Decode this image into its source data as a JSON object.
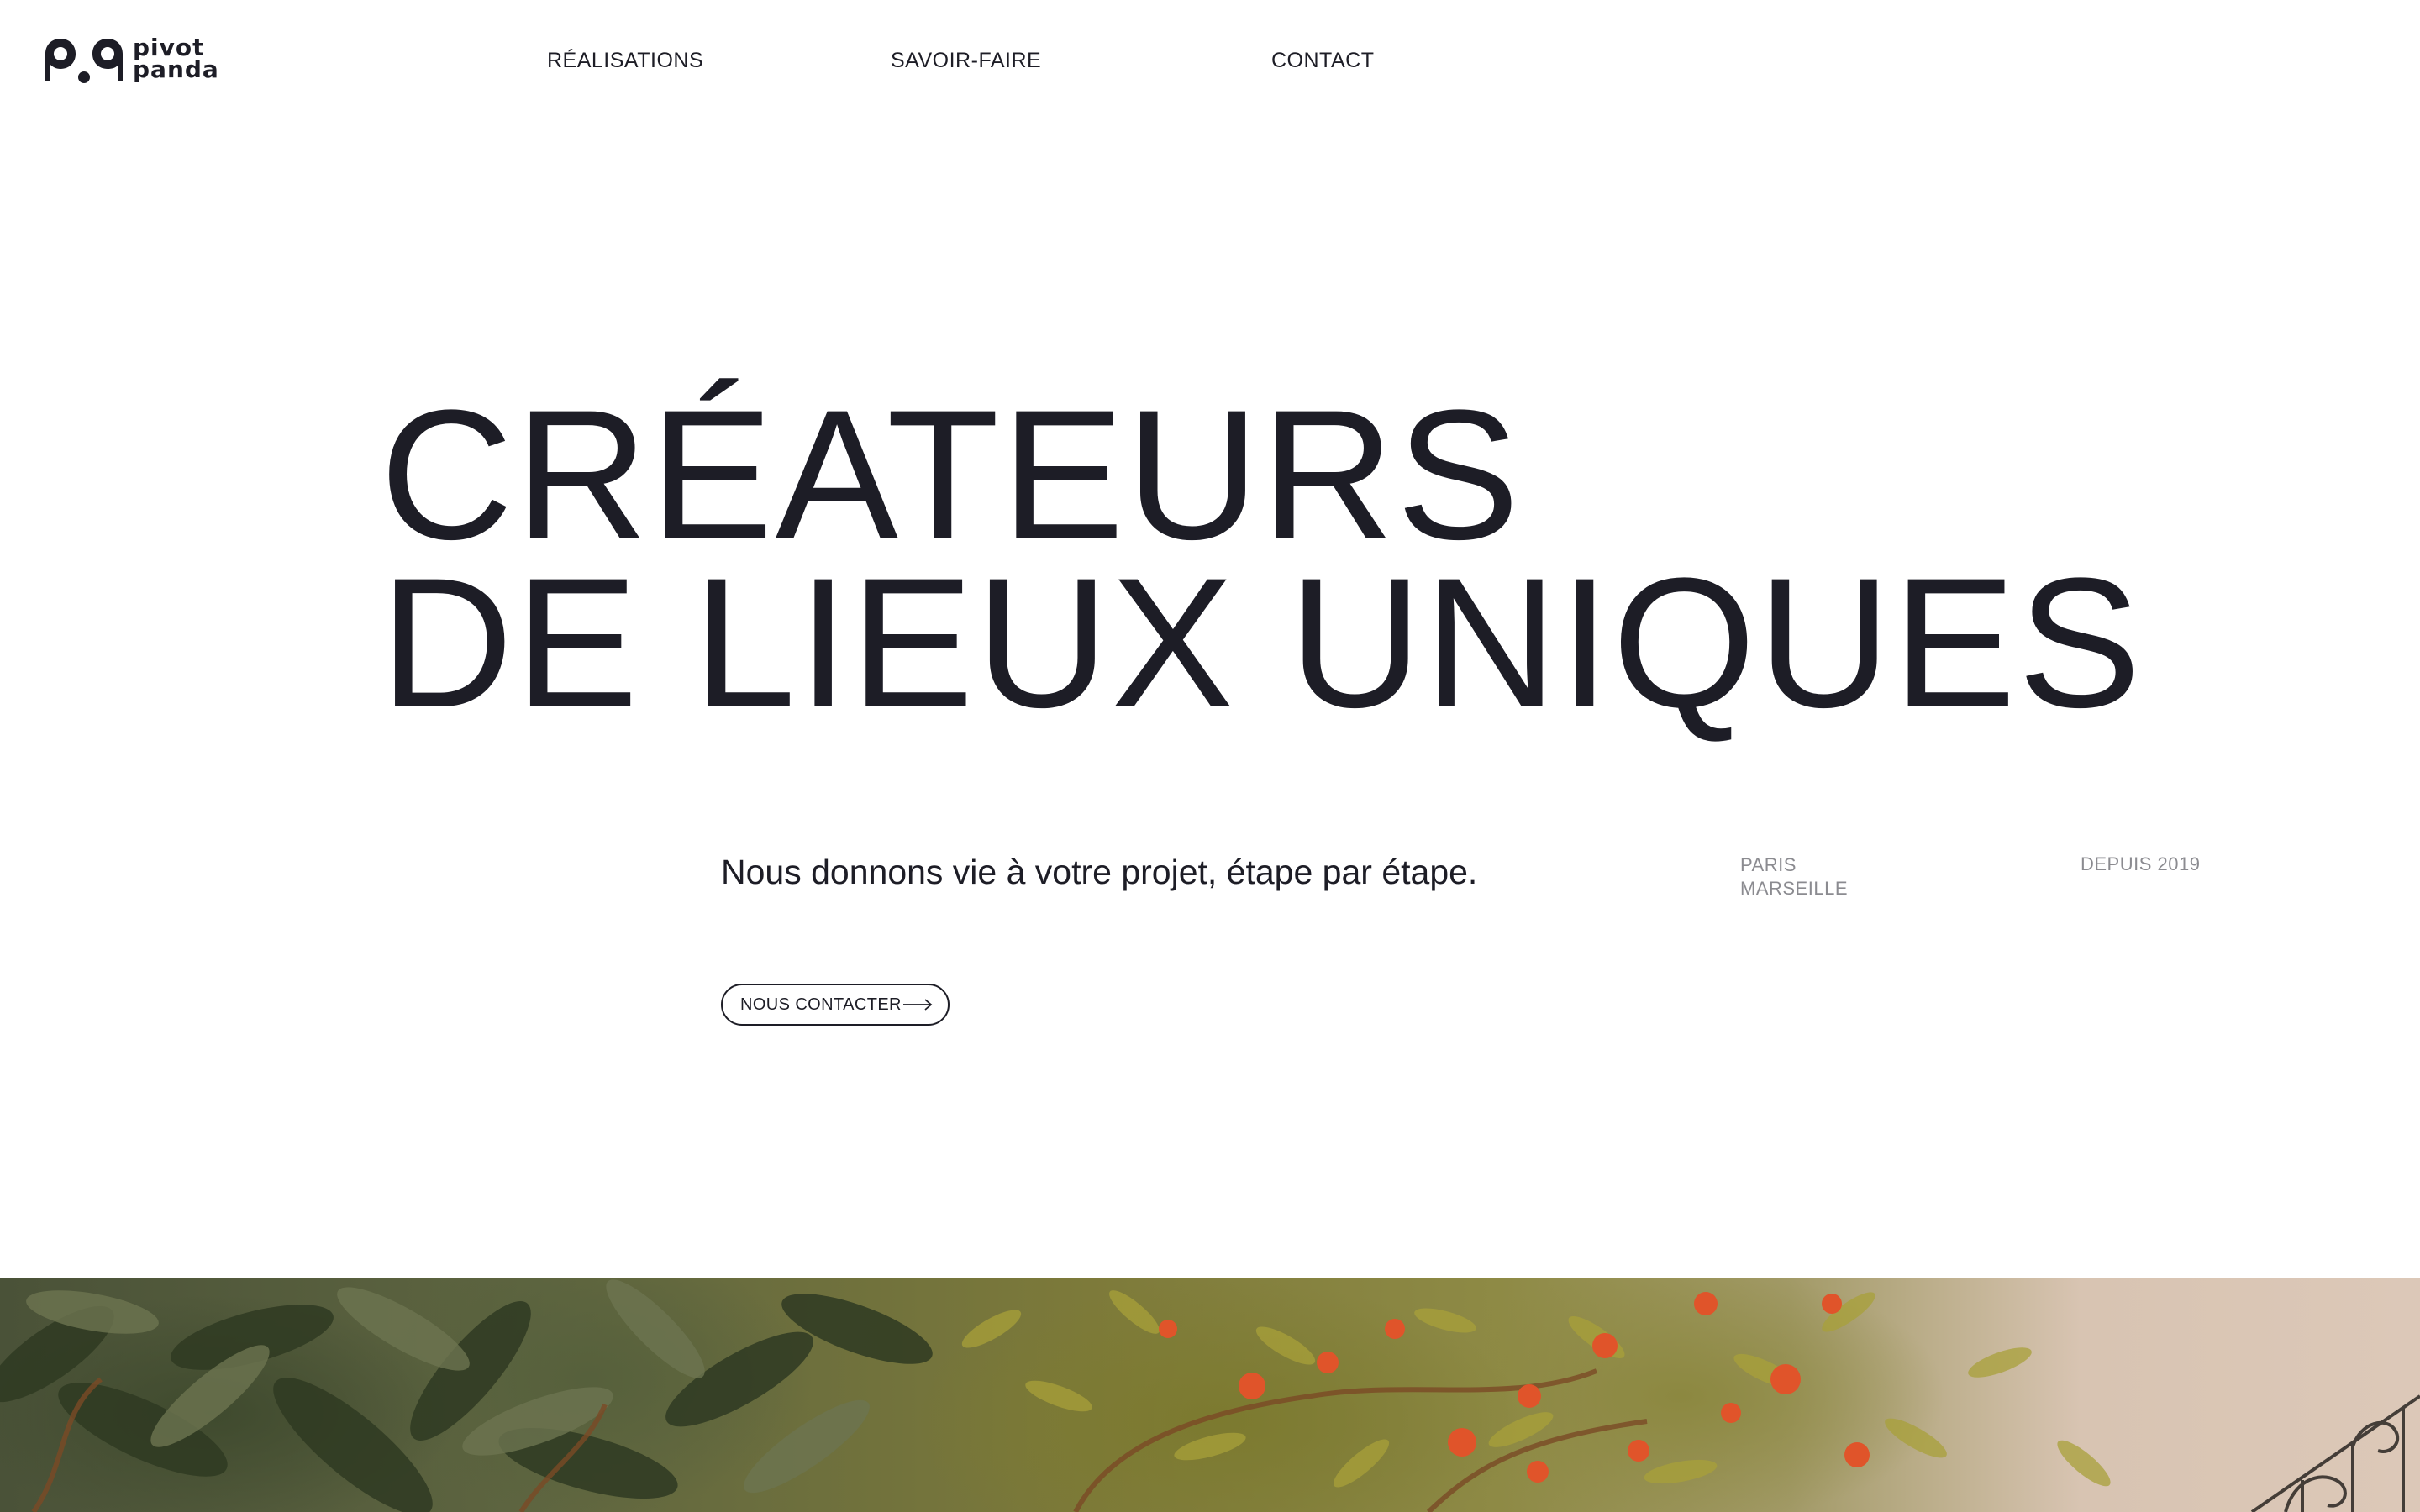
{
  "header": {
    "logo": {
      "line1": "pivot",
      "line2": "panda"
    },
    "nav": [
      {
        "label": "RÉALISATIONS"
      },
      {
        "label": "SAVOIR-FAIRE"
      },
      {
        "label": "CONTACT"
      }
    ]
  },
  "hero": {
    "title_line1": "CRÉATEURS",
    "title_line2": "DE LIEUX UNIQUES",
    "tagline": "Nous donnons vie à votre projet, étape par étape.",
    "locations": [
      "PARIS",
      "MARSEILLE"
    ],
    "since": "DEPUIS 2019",
    "cta_label": "NOUS CONTACTER",
    "cta_icon": "arrow-right-icon"
  },
  "photo": {
    "icon": "orange-tree-photo",
    "colors": {
      "leaf_dark": "#3f4a2e",
      "leaf_light": "#8e8a45",
      "orange": "#e0542a",
      "wall": "#dcc8b8"
    }
  },
  "colors": {
    "text": "#1d1d26",
    "muted": "#8b8b90",
    "background": "#ffffff"
  }
}
